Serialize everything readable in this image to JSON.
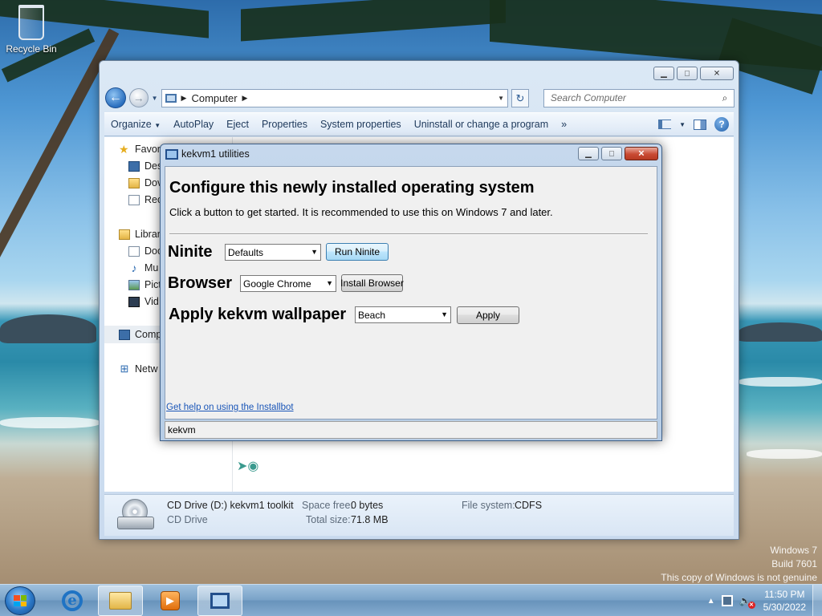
{
  "desktop": {
    "recycle_bin_label": "Recycle Bin",
    "watermark": {
      "line1": "Windows 7",
      "line2": "Build 7601",
      "line3": "This copy of Windows is not genuine"
    }
  },
  "explorer": {
    "address": {
      "crumbs": [
        "Computer"
      ]
    },
    "search_placeholder": "Search Computer",
    "command_bar": {
      "items": [
        "Organize",
        "AutoPlay",
        "Eject",
        "Properties",
        "System properties",
        "Uninstall or change a program"
      ],
      "overflow": "»"
    },
    "nav_pane": {
      "favorites": "Favor",
      "favorites_children": [
        "Des",
        "Dov",
        "Rec"
      ],
      "libraries": "Librar",
      "libraries_children": [
        "Doc",
        "Mu",
        "Pict",
        "Vid"
      ],
      "computer": "Comp",
      "network": "Netw"
    },
    "details": {
      "drive_name": "CD Drive (D:) kekvm1 toolkit",
      "drive_type": "CD Drive",
      "space_free_label": "Space free:",
      "space_free_value": "0 bytes",
      "total_size_label": "Total size:",
      "total_size_value": "71.8 MB",
      "file_system_label": "File system:",
      "file_system_value": "CDFS"
    }
  },
  "dialog": {
    "title": "kekvm1 utilities",
    "heading": "Configure this newly installed operating system",
    "description": "Click a button to get started. It is recommended to use this on Windows 7 and later.",
    "ninite": {
      "label": "Ninite",
      "selected": "Defaults",
      "button": "Run Ninite"
    },
    "browser": {
      "label": "Browser",
      "selected": "Google Chrome",
      "button": "Install Browser"
    },
    "wallpaper": {
      "label": "Apply kekvm wallpaper",
      "selected": "Beach",
      "button": "Apply"
    },
    "help_link": "Get help on using the Installbot",
    "status": "kekvm"
  },
  "taskbar": {
    "time": "11:50 PM",
    "date": "5/30/2022"
  }
}
